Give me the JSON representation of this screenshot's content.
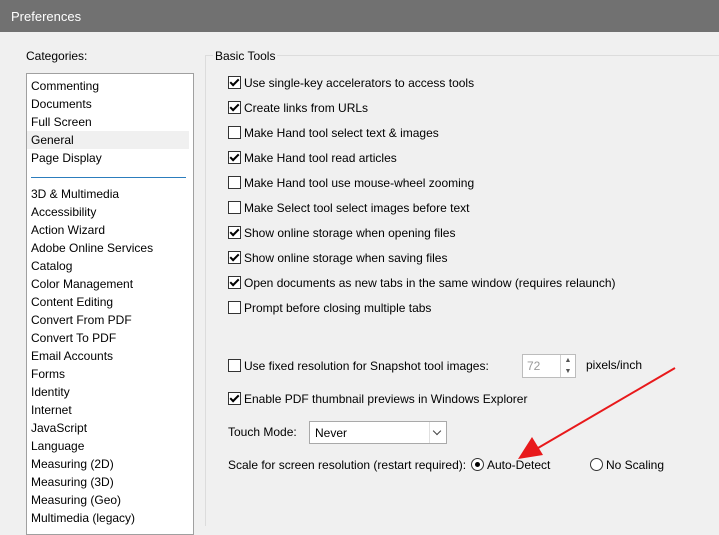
{
  "window": {
    "title": "Preferences"
  },
  "categories": {
    "label": "Categories:",
    "top_items": [
      "Commenting",
      "Documents",
      "Full Screen",
      "General",
      "Page Display"
    ],
    "selected": "General",
    "items": [
      "3D & Multimedia",
      "Accessibility",
      "Action Wizard",
      "Adobe Online Services",
      "Catalog",
      "Color Management",
      "Content Editing",
      "Convert From PDF",
      "Convert To PDF",
      "Email Accounts",
      "Forms",
      "Identity",
      "Internet",
      "JavaScript",
      "Language",
      "Measuring (2D)",
      "Measuring (3D)",
      "Measuring (Geo)",
      "Multimedia (legacy)"
    ]
  },
  "basic_tools": {
    "title": "Basic Tools",
    "options": [
      {
        "label": "Use single-key accelerators to access tools",
        "checked": true
      },
      {
        "label": "Create links from URLs",
        "checked": true
      },
      {
        "label": "Make Hand tool select text & images",
        "checked": false
      },
      {
        "label": "Make Hand tool read articles",
        "checked": true
      },
      {
        "label": "Make Hand tool use mouse-wheel zooming",
        "checked": false
      },
      {
        "label": "Make Select tool select images before text",
        "checked": false
      },
      {
        "label": "Show online storage when opening files",
        "checked": true
      },
      {
        "label": "Show online storage when saving files",
        "checked": true
      },
      {
        "label": "Open documents as new tabs in the same window (requires relaunch)",
        "checked": true
      },
      {
        "label": "Prompt before closing multiple tabs",
        "checked": false
      }
    ],
    "snapshot": {
      "label": "Use fixed resolution for Snapshot tool images:",
      "checked": false,
      "value": "72",
      "unit": "pixels/inch"
    },
    "thumbnail": {
      "label": "Enable PDF thumbnail previews in Windows Explorer",
      "checked": true
    },
    "touch_mode": {
      "label": "Touch Mode:",
      "value": "Never"
    },
    "scale": {
      "label": "Scale for screen resolution (restart required):",
      "options": [
        {
          "label": "Auto-Detect",
          "selected": true
        },
        {
          "label": "No Scaling",
          "selected": false
        }
      ]
    }
  },
  "annotation": {
    "arrow_color": "#e8191b"
  }
}
